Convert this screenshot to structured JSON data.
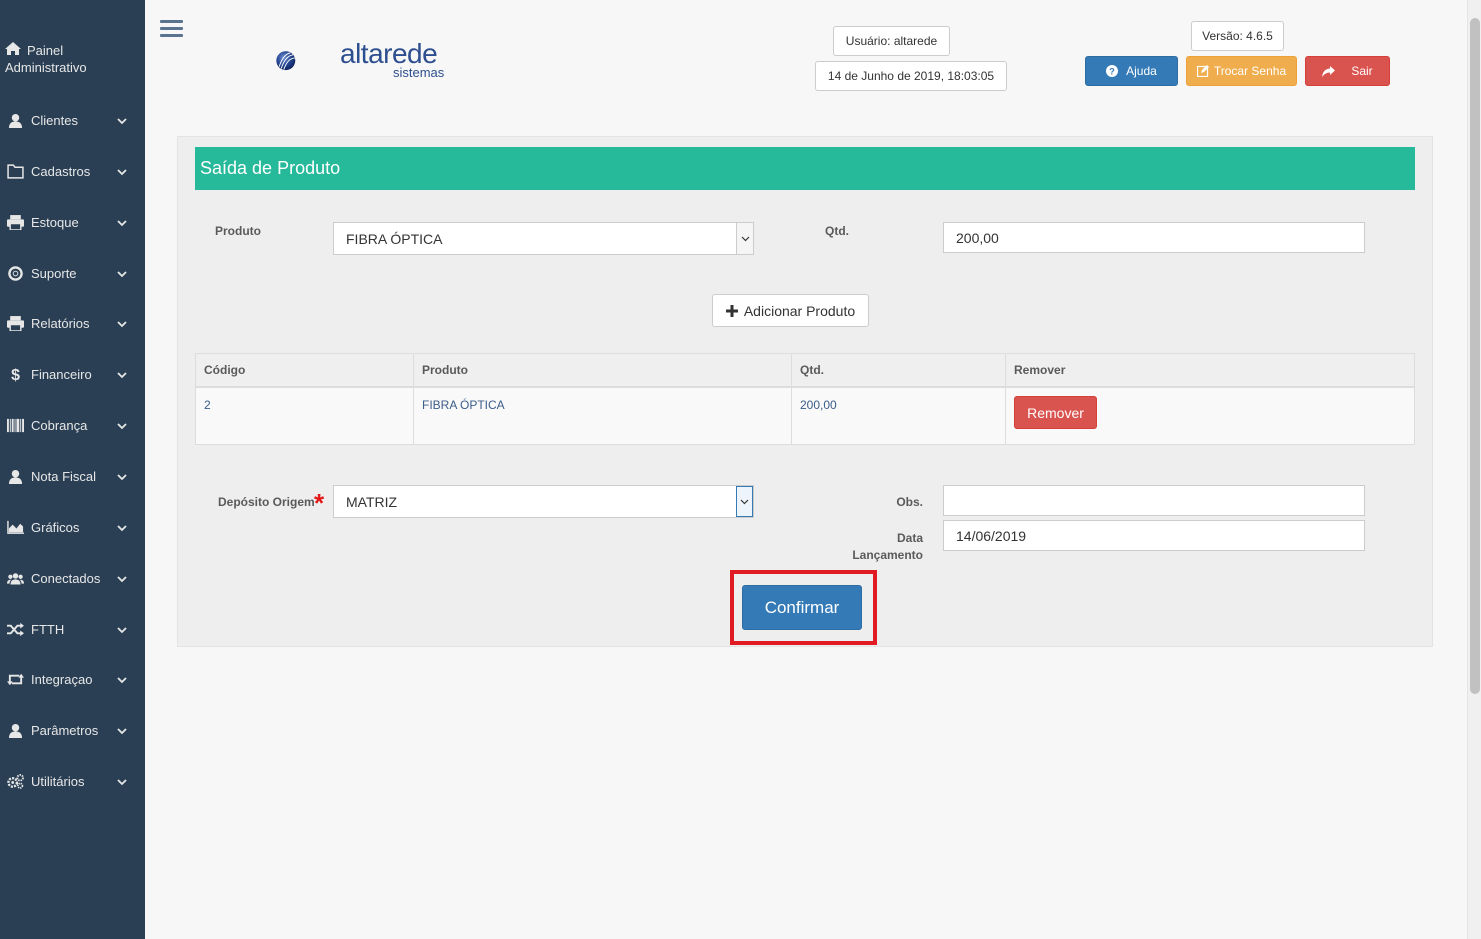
{
  "sidebar": {
    "brand": [
      "Painel",
      "Administrativo"
    ],
    "items": [
      {
        "label": "Clientes",
        "icon": "user-icon"
      },
      {
        "label": "Cadastros",
        "icon": "folder-icon"
      },
      {
        "label": "Estoque",
        "icon": "print-icon"
      },
      {
        "label": "Suporte",
        "icon": "lifebuoy-icon"
      },
      {
        "label": "Relatórios",
        "icon": "print-icon"
      },
      {
        "label": "Financeiro",
        "icon": "dollar-icon"
      },
      {
        "label": "Cobrança",
        "icon": "barcode-icon"
      },
      {
        "label": "Nota Fiscal",
        "icon": "user-icon"
      },
      {
        "label": "Gráficos",
        "icon": "area-chart-icon"
      },
      {
        "label": "Conectados",
        "icon": "users-icon"
      },
      {
        "label": "FTTH",
        "icon": "random-icon"
      },
      {
        "label": "Integraçao",
        "icon": "retweet-icon"
      },
      {
        "label": "Parâmetros",
        "icon": "user-icon"
      },
      {
        "label": "Utilitários",
        "icon": "cogs-icon"
      }
    ]
  },
  "header": {
    "logo_text": "altarede",
    "logo_sub": "sistemas",
    "user": "Usuário: altarede",
    "datetime": "14 de Junho de 2019, 18:03:05",
    "version": "Versão: 4.6.5",
    "help_label": "Ajuda",
    "password_label": "Trocar Senha",
    "logout_label": "Sair"
  },
  "form": {
    "title": "Saída de Produto",
    "product_label": "Produto",
    "product_value": "FIBRA ÓPTICA",
    "qty_label": "Qtd.",
    "qty_value": "200,00",
    "add_label": "Adicionar Produto",
    "table": {
      "headers": [
        "Código",
        "Produto",
        "Qtd.",
        "Remover"
      ],
      "rows": [
        {
          "codigo": "2",
          "produto": "FIBRA ÓPTICA",
          "qtd": "200,00",
          "remove_label": "Remover"
        }
      ]
    },
    "deposit_label": "Depósito Origem",
    "deposit_value": "MATRIZ",
    "obs_label": "Obs.",
    "obs_value": "",
    "date_label_1": "Data",
    "date_label_2": "Lançamento",
    "date_value": "14/06/2019",
    "confirm_label": "Confirmar"
  },
  "colors": {
    "sidebar_bg": "#2a3f54",
    "title_bar": "#26b99a",
    "primary": "#337ab7",
    "warning": "#f0ad4e",
    "danger": "#d9534f",
    "highlight": "#e01b24"
  }
}
